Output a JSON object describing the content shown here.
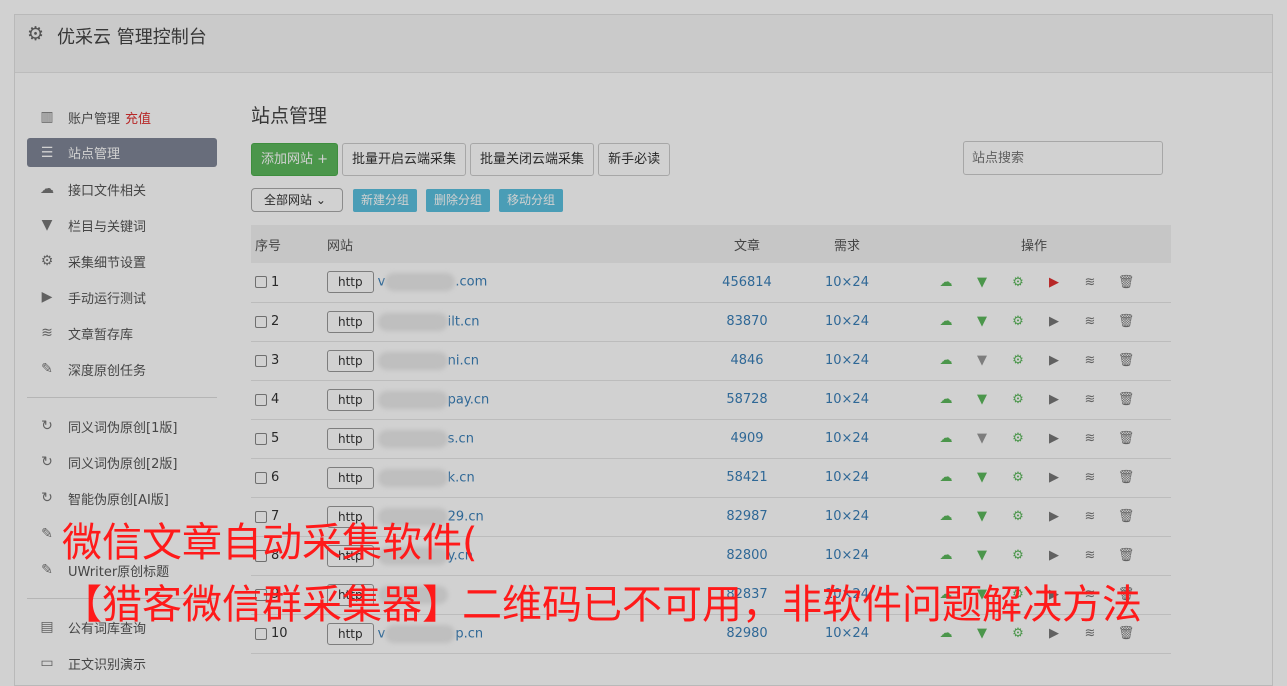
{
  "header": {
    "title": "优采云 管理控制台",
    "icon": "gear-icon"
  },
  "sidebar": {
    "items": [
      {
        "label": "账户管理",
        "extra": "充值",
        "icon": "bar-chart-icon",
        "active": false
      },
      {
        "label": "站点管理",
        "icon": "server-icon",
        "active": true
      },
      {
        "label": "接口文件相关",
        "icon": "cloud-upload-icon",
        "active": false
      },
      {
        "label": "栏目与关键词",
        "icon": "filter-icon",
        "active": false
      },
      {
        "label": "采集细节设置",
        "icon": "gears-icon",
        "active": false
      },
      {
        "label": "手动运行测试",
        "icon": "play-circle-icon",
        "active": false
      },
      {
        "label": "文章暂存库",
        "icon": "database-icon",
        "active": false
      },
      {
        "label": "深度原创任务",
        "icon": "edit-icon",
        "active": false
      }
    ],
    "items2": [
      {
        "label": "同义词伪原创[1版]",
        "icon": "refresh-icon"
      },
      {
        "label": "同义词伪原创[2版]",
        "icon": "refresh-icon"
      },
      {
        "label": "智能伪原创[AI版]",
        "icon": "refresh-icon"
      },
      {
        "label": "",
        "icon": "edit-icon"
      },
      {
        "label": "UWriter原创标题",
        "icon": "edit-icon"
      }
    ],
    "items3": [
      {
        "label": "公有词库查询",
        "icon": "book-icon"
      },
      {
        "label": "正文识别演示",
        "icon": "monitor-icon"
      }
    ]
  },
  "main": {
    "title": "站点管理",
    "toolbar": {
      "add_site": "添加网站 +",
      "batch_open": "批量开启云端采集",
      "batch_close": "批量关闭云端采集",
      "newbie": "新手必读",
      "search_placeholder": "站点搜索"
    },
    "group": {
      "select_value": "全部网站",
      "new_group": "新建分组",
      "delete_group": "删除分组",
      "move_group": "移动分组"
    },
    "table": {
      "headers": {
        "no": "序号",
        "site": "网站",
        "articles": "文章",
        "need": "需求",
        "ops": "操作"
      },
      "rows": [
        {
          "no": "1",
          "prefix": "http",
          "site": "v",
          "site_suffix": ".com",
          "articles": "456814",
          "need": "10×24",
          "filter_on": true,
          "play_red": true
        },
        {
          "no": "2",
          "prefix": "http",
          "site": "",
          "site_suffix": "ilt.cn",
          "articles": "83870",
          "need": "10×24",
          "filter_on": true,
          "play_red": false
        },
        {
          "no": "3",
          "prefix": "http",
          "site": "",
          "site_suffix": "ni.cn",
          "articles": "4846",
          "need": "10×24",
          "filter_on": false,
          "play_red": false
        },
        {
          "no": "4",
          "prefix": "http",
          "site": "",
          "site_suffix": "pay.cn",
          "articles": "58728",
          "need": "10×24",
          "filter_on": true,
          "play_red": false
        },
        {
          "no": "5",
          "prefix": "http",
          "site": "",
          "site_suffix": "s.cn",
          "articles": "4909",
          "need": "10×24",
          "filter_on": false,
          "play_red": false
        },
        {
          "no": "6",
          "prefix": "http",
          "site": "",
          "site_suffix": "k.cn",
          "articles": "58421",
          "need": "10×24",
          "filter_on": true,
          "play_red": false
        },
        {
          "no": "7",
          "prefix": "http",
          "site": "",
          "site_suffix": "29.cn",
          "articles": "82987",
          "need": "10×24",
          "filter_on": true,
          "play_red": false
        },
        {
          "no": "8",
          "prefix": "http",
          "site": "",
          "site_suffix": "y.cn",
          "articles": "82800",
          "need": "10×24",
          "filter_on": true,
          "play_red": false
        },
        {
          "no": "9",
          "prefix": "http",
          "site": "",
          "site_suffix": "",
          "articles": "82837",
          "need": "10×24",
          "filter_on": true,
          "play_red": false
        },
        {
          "no": "10",
          "prefix": "http",
          "site": "v",
          "site_suffix": "p.cn",
          "articles": "82980",
          "need": "10×24",
          "filter_on": true,
          "play_red": false
        }
      ]
    }
  },
  "overlay": {
    "line1": "微信文章自动采集软件(",
    "line2": "【猎客微信群采集器】二维码已不可用，非软件问题解决方法"
  }
}
